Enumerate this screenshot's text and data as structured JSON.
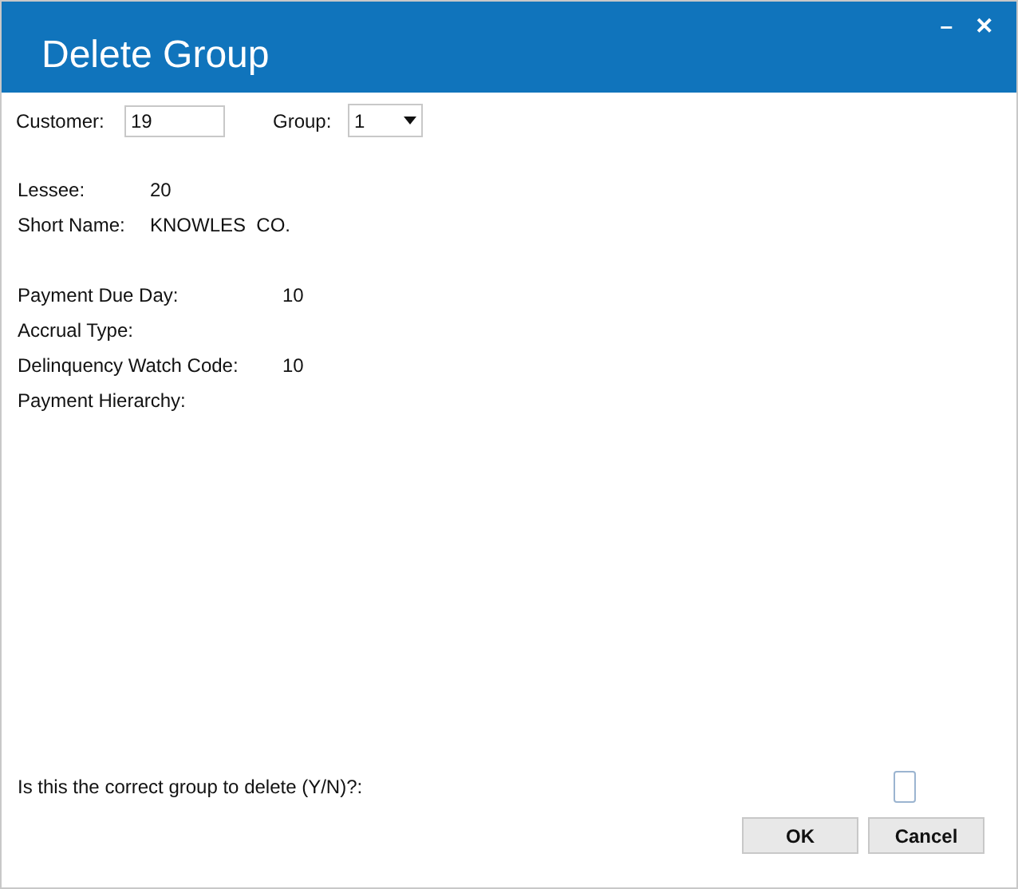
{
  "window": {
    "title": "Delete Group",
    "controls": [
      "–",
      "✕"
    ]
  },
  "customer": {
    "label": "Customer:",
    "value": "19"
  },
  "group": {
    "label": "Group:",
    "value": "1"
  },
  "info": [
    {
      "label": "Lessee:",
      "value": "20"
    },
    {
      "label": "Short Name:",
      "value": "KNOWLES  CO."
    }
  ],
  "details": [
    {
      "label": "Payment Due Day:",
      "value": "10"
    },
    {
      "label": "Accrual Type:"
    },
    {
      "label": "Delinquency Watch Code:",
      "value": "10"
    },
    {
      "label": "Payment Hierarchy:"
    }
  ],
  "confirm": {
    "label": "Is this the correct group to delete (Y/N)?:"
  },
  "buttons": [
    "OK",
    "Cancel"
  ]
}
